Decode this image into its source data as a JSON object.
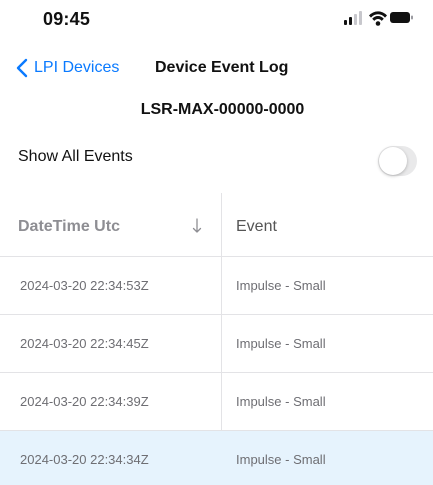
{
  "status_bar": {
    "time": "09:45",
    "icons": [
      "signal-icon",
      "wifi-icon",
      "battery-icon"
    ]
  },
  "nav": {
    "back_label": "LPI Devices",
    "title": "Device Event Log"
  },
  "device": {
    "id": "LSR-MAX-00000-0000"
  },
  "filter": {
    "show_all_label": "Show All Events",
    "show_all_enabled": false
  },
  "table": {
    "columns": [
      "DateTime Utc",
      "Event"
    ],
    "sort_indicator": "↓",
    "rows": [
      {
        "datetime": "2024-03-20 22:34:53Z",
        "event": "Impulse - Small",
        "selected": false
      },
      {
        "datetime": "2024-03-20 22:34:45Z",
        "event": "Impulse - Small",
        "selected": false
      },
      {
        "datetime": "2024-03-20 22:34:39Z",
        "event": "Impulse - Small",
        "selected": false
      },
      {
        "datetime": "2024-03-20 22:34:34Z",
        "event": "Impulse - Small",
        "selected": true
      }
    ]
  },
  "colors": {
    "accent": "#0a7aff",
    "selected_row": "#e6f3fd",
    "header_text": "#8e8e93",
    "toggle_off": "#e9e9ea"
  }
}
